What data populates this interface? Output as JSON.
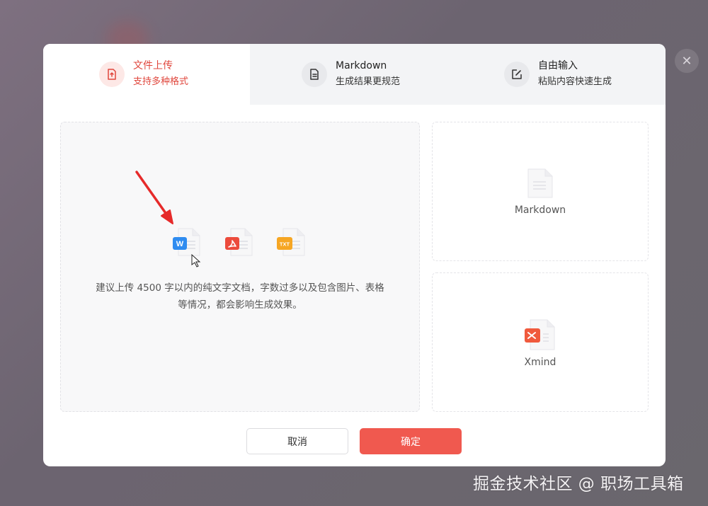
{
  "tabs": [
    {
      "title": "文件上传",
      "subtitle": "支持多种格式",
      "active": true,
      "icon": "upload-file-icon"
    },
    {
      "title": "Markdown",
      "subtitle": "生成结果更规范",
      "active": false,
      "icon": "document-icon"
    },
    {
      "title": "自由输入",
      "subtitle": "粘贴内容快速生成",
      "active": false,
      "icon": "edit-icon"
    }
  ],
  "upload": {
    "file_types": [
      "W",
      "PDF",
      "TXT"
    ],
    "hint_line1": "建议上传 4500 字以内的纯文字文档，字数过多以及包含图片、表格",
    "hint_line2": "等情况，都会影响生成效果。"
  },
  "formats": [
    {
      "label": "Markdown",
      "icon": "markdown-file-icon"
    },
    {
      "label": "Xmind",
      "icon": "xmind-file-icon"
    }
  ],
  "buttons": {
    "cancel": "取消",
    "confirm": "确定"
  },
  "close_label": "✕",
  "watermark": "掘金技术社区 @ 职场工具箱",
  "colors": {
    "accent": "#f0594f",
    "accent_text": "#e0473d",
    "word": "#2f8cf0",
    "pdf": "#ec4b3c",
    "txt": "#f6a623"
  }
}
